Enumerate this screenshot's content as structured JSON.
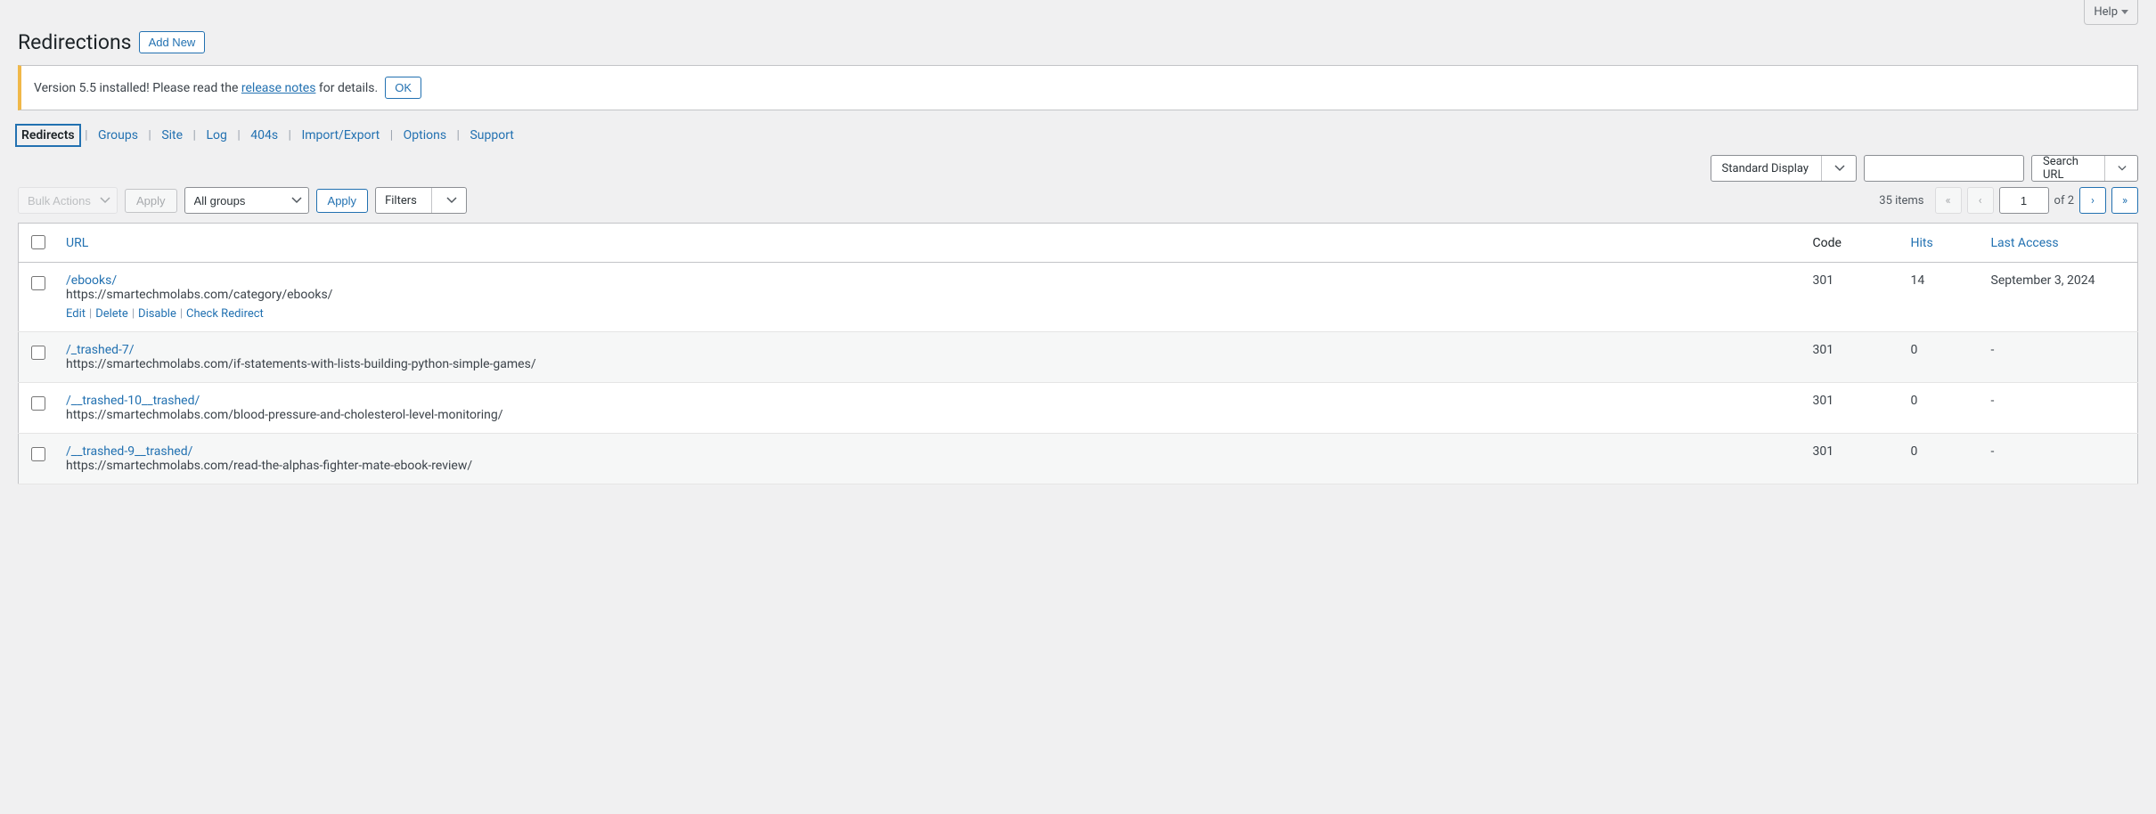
{
  "help_label": "Help",
  "page_title": "Redirections",
  "add_new_label": "Add New",
  "notice": {
    "prefix": "Version 5.5 installed! Please read the ",
    "link_text": "release notes",
    "suffix": " for details.",
    "ok_label": "OK"
  },
  "subnav": {
    "redirects": "Redirects",
    "groups": "Groups",
    "site": "Site",
    "log": "Log",
    "404s": "404s",
    "import_export": "Import/Export",
    "options": "Options",
    "support": "Support"
  },
  "toolbar": {
    "display_mode": "Standard Display",
    "search_btn": "Search URL",
    "bulk_actions": "Bulk Actions",
    "apply1": "Apply",
    "all_groups": "All groups",
    "apply2": "Apply",
    "filters": "Filters"
  },
  "pagination": {
    "items_count": "35 items",
    "first": "«",
    "prev": "‹",
    "current_page": "1",
    "of_label": "of 2",
    "next": "›",
    "last": "»"
  },
  "table": {
    "headers": {
      "url": "URL",
      "code": "Code",
      "hits": "Hits",
      "last_access": "Last Access"
    },
    "row_actions": {
      "edit": "Edit",
      "delete": "Delete",
      "disable": "Disable",
      "check": "Check Redirect"
    },
    "rows": [
      {
        "src": "/ebooks/",
        "dst": "https://smartechmolabs.com/category/ebooks/",
        "code": "301",
        "hits": "14",
        "last": "September 3, 2024",
        "show_actions": true
      },
      {
        "src": "/_trashed-7/",
        "dst": "https://smartechmolabs.com/if-statements-with-lists-building-python-simple-games/",
        "code": "301",
        "hits": "0",
        "last": "-",
        "show_actions": false
      },
      {
        "src": "/__trashed-10__trashed/",
        "dst": "https://smartechmolabs.com/blood-pressure-and-cholesterol-level-monitoring/",
        "code": "301",
        "hits": "0",
        "last": "-",
        "show_actions": false
      },
      {
        "src": "/__trashed-9__trashed/",
        "dst": "https://smartechmolabs.com/read-the-alphas-fighter-mate-ebook-review/",
        "code": "301",
        "hits": "0",
        "last": "-",
        "show_actions": false
      }
    ]
  }
}
